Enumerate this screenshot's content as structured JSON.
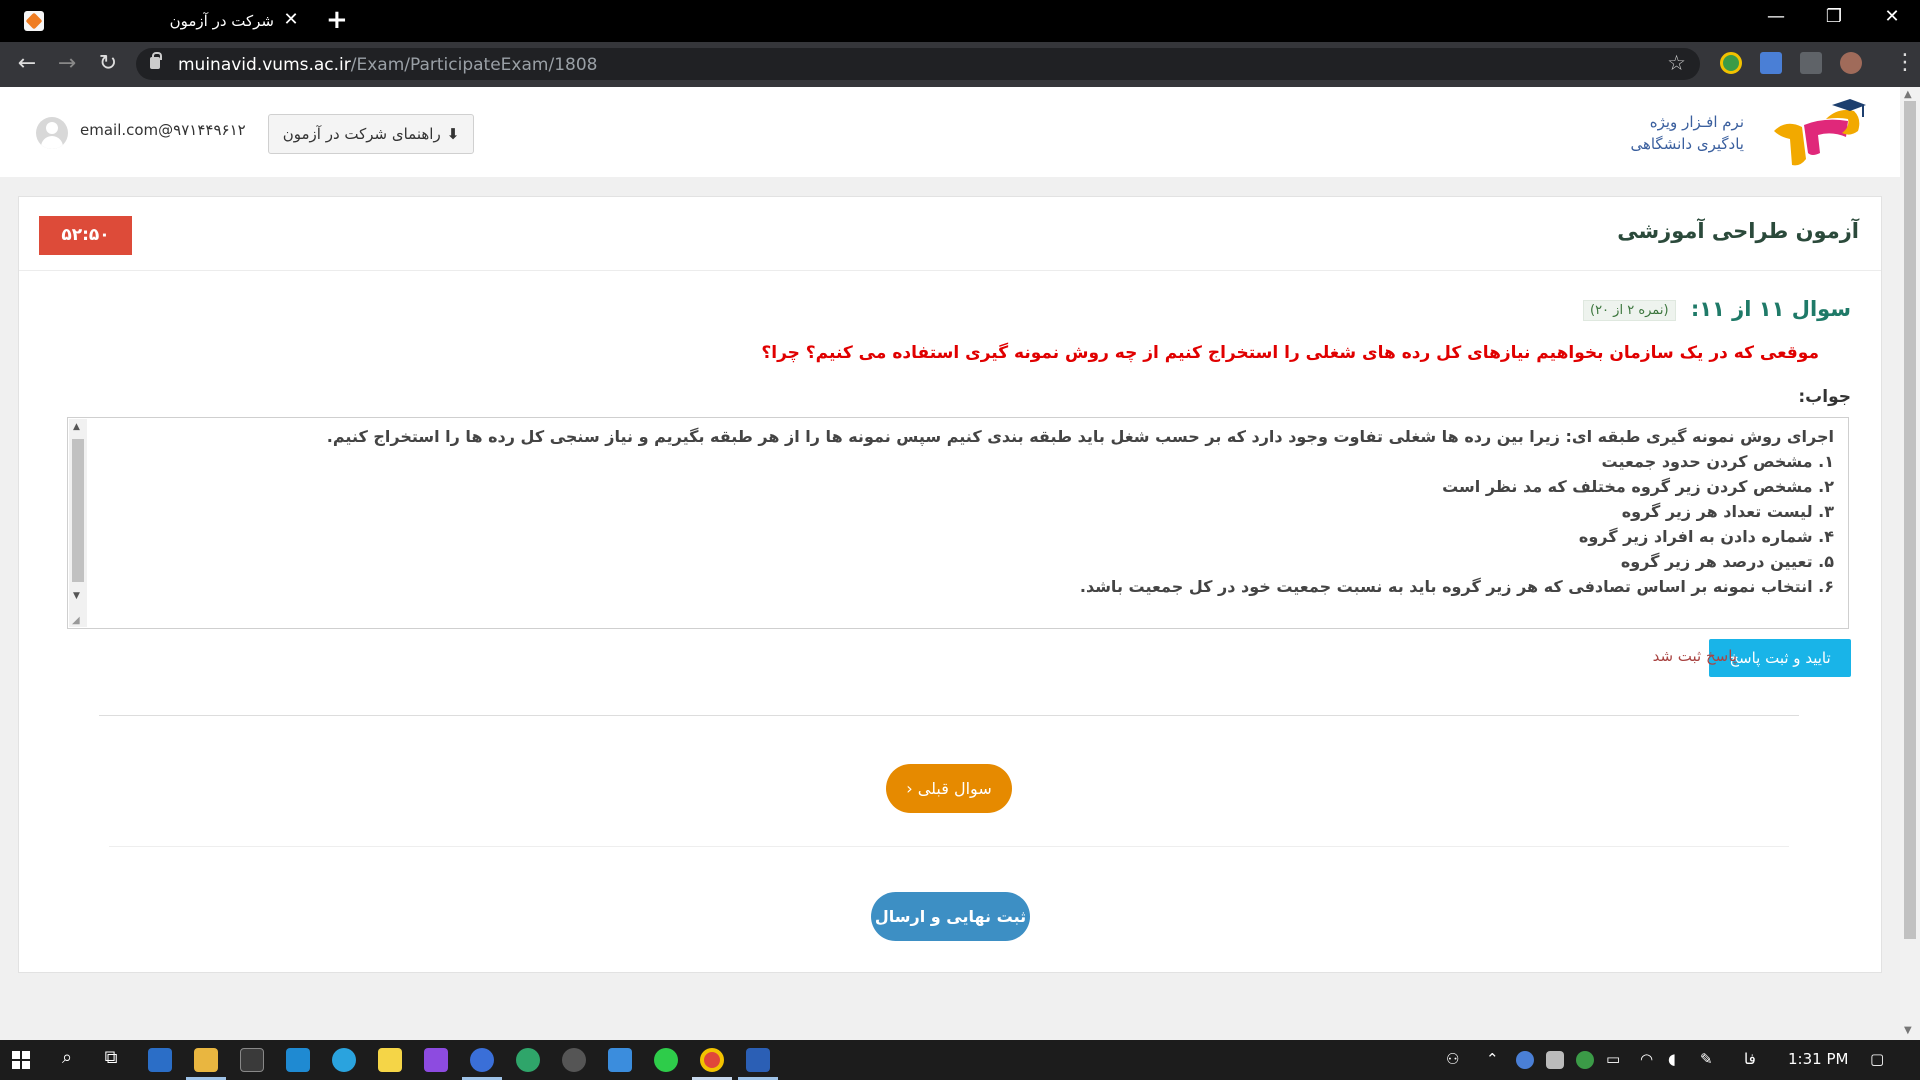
{
  "browser": {
    "tab_title": "شرکت در آزمون",
    "tab_close": "✕",
    "new_tab": "+",
    "url_host": "muinavid.vums.ac.ir",
    "url_path": "/Exam/ParticipateExam/1808",
    "controls": {
      "minimize": "—",
      "restore": "❐",
      "close": "✕"
    },
    "nav": {
      "back": "←",
      "forward": "→",
      "reload": "↻"
    }
  },
  "header": {
    "logo_line1": "نرم افـزار ویژه",
    "logo_line2": "یادگیری دانشگاهی",
    "user_email": "email.com@۹۷۱۴۴۹۶۱۲",
    "guide_button": "راهنمای شرکت در آزمون"
  },
  "exam": {
    "title": "آزمون طراحی آموزشی",
    "timer": "۵۲:۵۰"
  },
  "question": {
    "heading": "سوال ۱۱ از ۱۱:",
    "grade": "(نمره ۲ از ۲۰)",
    "text": "موقعی که در یک سازمان بخواهیم نیازهای کل رده های شغلی را استخراج کنیم از چه روش نمونه گیری استفاده می  کنیم؟ چرا؟",
    "answer_label": "جواب:",
    "answer_lines": [
      "اجرای روش نمونه گیری طبقه ای: زیرا بین رده ها شغلی تفاوت وجود دارد که بر حسب شغل باید طبقه بندی کنیم سپس نمونه ها را از هر طبقه بگیریم و نیاز سنجی کل رده ها را استخراج کنیم.",
      "۱. مشخص کردن حدود جمعیت",
      "۲. مشخص کردن زیر گروه مختلف که مد نظر است",
      "۳. لیست تعداد هر زیر گروه",
      "۴. شماره دادن به افراد زیر گروه",
      "۵. تعیین درصد هر زیر گروه",
      "۶. انتخاب نمونه بر اساس تصادفی که هر زیر گروه باید به نسبت جمعیت خود در کل جمعیت باشد."
    ],
    "confirm_button": "تایید و ثبت پاسخ",
    "saved_message": "پاسخ ثبت شد",
    "prev_button": "سوال قبلی",
    "submit_button": "ثبت نهایی و ارسال"
  },
  "taskbar": {
    "lang": "فا",
    "time": "1:31 PM"
  },
  "colors": {
    "timer_bg": "#dd4b39",
    "question_red": "#e00000",
    "heading_teal": "#1f7a68",
    "confirm_cyan": "#19b4e8",
    "prev_orange": "#e68a00",
    "submit_blue": "#3d8fc4"
  }
}
